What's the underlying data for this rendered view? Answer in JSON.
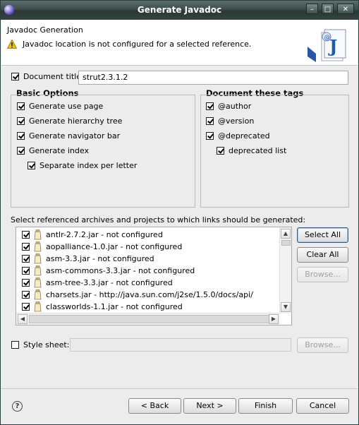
{
  "window": {
    "title": "Generate Javadoc"
  },
  "banner": {
    "heading": "Javadoc Generation",
    "warning": "Javadoc location is not configured for a selected reference."
  },
  "document_title": {
    "label": "Document title:",
    "checked": true,
    "value": "strut2.3.1.2"
  },
  "basic_options": {
    "title": "Basic Options",
    "items": [
      {
        "label": "Generate use page",
        "checked": true
      },
      {
        "label": "Generate hierarchy tree",
        "checked": true
      },
      {
        "label": "Generate navigator bar",
        "checked": true
      },
      {
        "label": "Generate index",
        "checked": true
      },
      {
        "label": "Separate index per letter",
        "checked": true
      }
    ]
  },
  "document_tags": {
    "title": "Document these tags",
    "items": [
      {
        "label": "@author",
        "checked": true
      },
      {
        "label": "@version",
        "checked": true
      },
      {
        "label": "@deprecated",
        "checked": true
      },
      {
        "label": "deprecated list",
        "checked": true
      }
    ]
  },
  "references": {
    "label": "Select referenced archives and projects to which links should be generated:",
    "items": [
      {
        "label": "antlr-2.7.2.jar - not configured",
        "checked": true
      },
      {
        "label": "aopalliance-1.0.jar - not configured",
        "checked": true
      },
      {
        "label": "asm-3.3.jar - not configured",
        "checked": true
      },
      {
        "label": "asm-commons-3.3.jar - not configured",
        "checked": true
      },
      {
        "label": "asm-tree-3.3.jar - not configured",
        "checked": true
      },
      {
        "label": "charsets.jar - http://java.sun.com/j2se/1.5.0/docs/api/",
        "checked": true
      },
      {
        "label": "classworlds-1.1.jar - not configured",
        "checked": true
      }
    ],
    "buttons": {
      "select_all": "Select All",
      "clear_all": "Clear All",
      "browse": "Browse..."
    }
  },
  "style_sheet": {
    "label": "Style sheet:",
    "checked": false,
    "value": "",
    "browse": "Browse..."
  },
  "footer": {
    "back": "< Back",
    "next": "Next >",
    "finish": "Finish",
    "cancel": "Cancel",
    "help": "?"
  },
  "colors": {
    "titlebar": "#3c4d4b",
    "dialog_bg": "#ececec",
    "warning": "#f2c200",
    "jdoc_blue": "#1e5aa8"
  }
}
